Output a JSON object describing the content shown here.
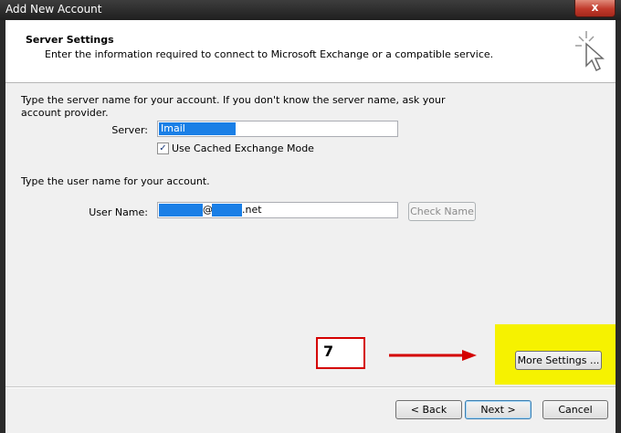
{
  "window": {
    "title": "Add New Account",
    "close_label": "x"
  },
  "header": {
    "title": "Server Settings",
    "subtitle": "Enter the information required to connect to Microsoft Exchange or a compatible service."
  },
  "server_section": {
    "instructions_line1": "Type the server name for your account. If you don't know the server name, ask your",
    "instructions_line2": "account provider.",
    "server_label": "Server:",
    "server_value": "Imail",
    "cached_mode_label": "Use Cached Exchange Mode",
    "cached_mode_checked": true,
    "checkmark": "✓"
  },
  "user_section": {
    "instructions": "Type the user name for your account.",
    "username_label": "User Name:",
    "username_at": "@",
    "username_domain": ".net",
    "check_name_label": "Check Name"
  },
  "annotation": {
    "step_number": "7",
    "highlight_color": "#f6f200",
    "arrow_color": "#d40000"
  },
  "buttons": {
    "more_settings": "More Settings ...",
    "back": "< Back",
    "next": "Next >",
    "cancel": "Cancel"
  }
}
